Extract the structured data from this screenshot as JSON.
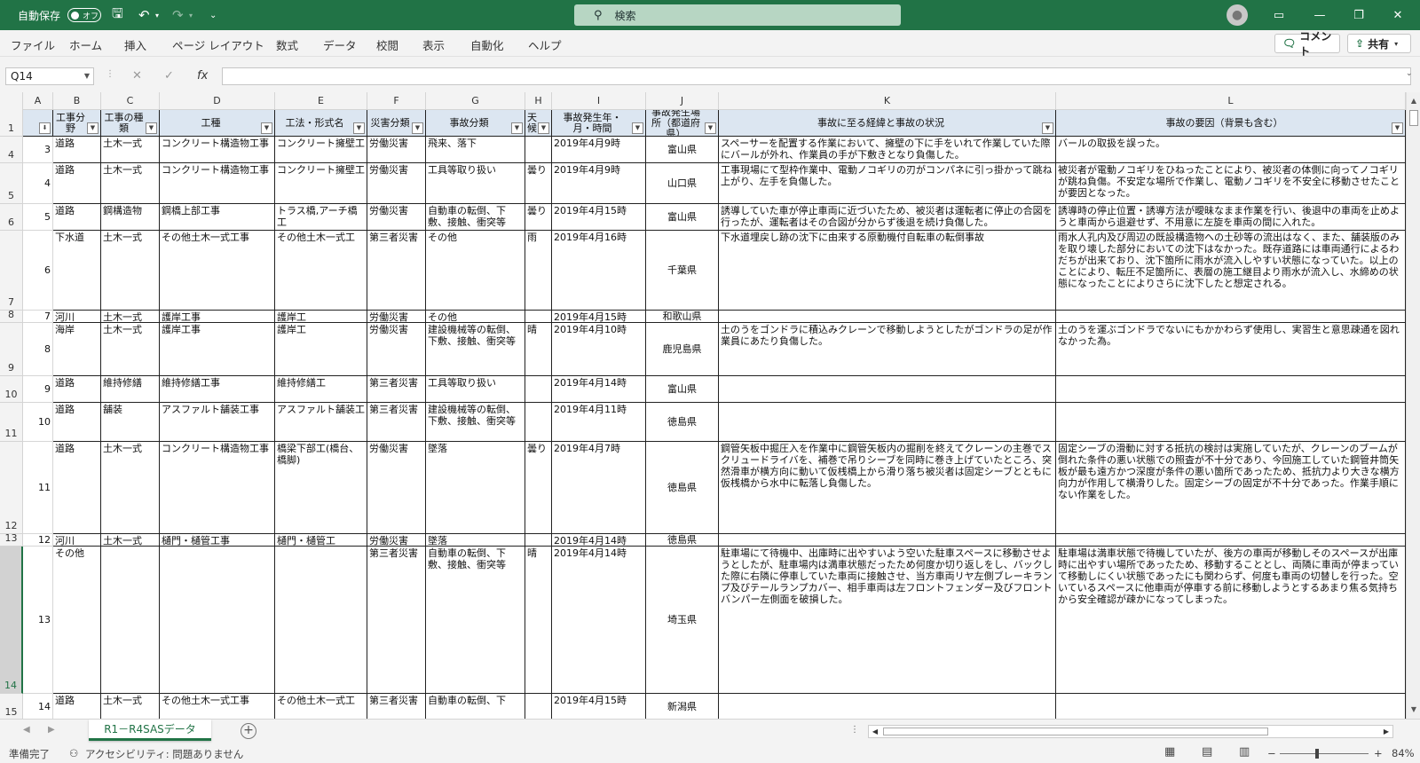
{
  "titlebar": {
    "autosave_label": "自動保存",
    "autosave_state": "オフ",
    "search_placeholder": "検索"
  },
  "ribbon": {
    "tabs": [
      "ファイル",
      "ホーム",
      "挿入",
      "ページ レイアウト",
      "数式",
      "データ",
      "校閲",
      "表示",
      "自動化",
      "ヘルプ"
    ],
    "comment_label": "コメント",
    "share_label": "共有"
  },
  "formula_bar": {
    "name_box": "Q14",
    "formula": ""
  },
  "columns": [
    "A",
    "B",
    "C",
    "D",
    "E",
    "F",
    "G",
    "H",
    "I",
    "J",
    "K",
    "L"
  ],
  "headers": {
    "A": "",
    "B": "工事分野",
    "C": "工事の種類",
    "D": "工種",
    "E": "工法・形式名",
    "F": "災害分類",
    "G": "事故分類",
    "H": "天候",
    "I": "事故発生年・月・時間",
    "J": "事故発生場所（都道府県）",
    "K": "事故に至る経緯と事故の状況",
    "L": "事故の要因（背景も含む）"
  },
  "rows": [
    {
      "rn": "4",
      "A": "3",
      "B": "道路",
      "C": "土木一式",
      "D": "コンクリート構造物工事",
      "E": "コンクリート擁壁工",
      "F": "労働災害",
      "G": "飛来、落下",
      "H": "",
      "I": "2019年4月9時",
      "J": "富山県",
      "K": "スペーサーを配置する作業において、擁壁の下に手をいれて作業していた際にバールが外れ、作業員の手が下敷きとなり負傷した。",
      "L": "バールの取扱を誤った。"
    },
    {
      "rn": "5",
      "A": "4",
      "B": "道路",
      "C": "土木一式",
      "D": "コンクリート構造物工事",
      "E": "コンクリート擁壁工",
      "F": "労働災害",
      "G": "工具等取り扱い",
      "H": "曇り",
      "I": "2019年4月9時",
      "J": "山口県",
      "K": "工事現場にて型枠作業中、電動ノコギリの刃がコンパネに引っ掛かって跳ね上がり、左手を負傷した。",
      "L": "被災者が電動ノコギリをひねったことにより、被災者の体側に向ってノコギリが跳ね負傷。不安定な場所で作業し、電動ノコギリを不安全に移動させたことが要因となった。"
    },
    {
      "rn": "6",
      "A": "5",
      "B": "道路",
      "C": "鋼構造物",
      "D": "鋼橋上部工事",
      "E": "トラス橋,アーチ橋工",
      "F": "労働災害",
      "G": "自動車の転倒、下敷、接触、衝突等",
      "H": "曇り",
      "I": "2019年4月15時",
      "J": "富山県",
      "K": "誘導していた車が停止車両に近づいたため、被災者は運転者に停止の合図を行ったが、運転者はその合図が分からず後退を続け負傷した。",
      "L": "誘導時の停止位置・誘導方法が曖昧なまま作業を行い、後退中の車両を止めようと車両から退避せず、不用意に左旋を車両の間に入れた。"
    },
    {
      "rn": "7",
      "A": "6",
      "B": "下水道",
      "C": "土木一式",
      "D": "その他土木一式工事",
      "E": "その他土木一式工",
      "F": "第三者災害",
      "G": "その他",
      "H": "雨",
      "I": "2019年4月16時",
      "J": "千葉県",
      "K": "下水道埋戻し跡の沈下に由来する原動機付自転車の転倒事故",
      "L": "雨水人孔内及び周辺の既設構造物への土砂等の流出はなく、また、舗装版のみを取り壊した部分においての沈下はなかった。既存道路には車両通行によるわだちが出来ており、沈下箇所に雨水が流入しやすい状態になっていた。以上のことにより、転圧不足箇所に、表層の施工継目より雨水が流入し、水締めの状態になったことによりさらに沈下したと想定される。"
    },
    {
      "rn": "8",
      "A": "7",
      "B": "河川",
      "C": "土木一式",
      "D": "護岸工事",
      "E": "護岸工",
      "F": "労働災害",
      "G": "その他",
      "H": "",
      "I": "2019年4月15時",
      "J": "和歌山県",
      "K": "",
      "L": ""
    },
    {
      "rn": "9",
      "A": "8",
      "B": "海岸",
      "C": "土木一式",
      "D": "護岸工事",
      "E": "護岸工",
      "F": "労働災害",
      "G": "建設機械等の転倒、下敷、接触、衝突等",
      "H": "晴",
      "I": "2019年4月10時",
      "J": "鹿児島県",
      "K": "土のうをゴンドラに積込みクレーンで移動しようとしたがゴンドラの足が作業員にあたり負傷した。",
      "L": "土のうを運ぶゴンドラでないにもかかわらず使用し、実習生と意思疎通を図れなかった為。"
    },
    {
      "rn": "10",
      "A": "9",
      "B": "道路",
      "C": "維持修繕",
      "D": "維持修繕工事",
      "E": "維持修繕工",
      "F": "第三者災害",
      "G": "工具等取り扱い",
      "H": "",
      "I": "2019年4月14時",
      "J": "富山県",
      "K": "",
      "L": ""
    },
    {
      "rn": "11",
      "A": "10",
      "B": "道路",
      "C": "舗装",
      "D": "アスファルト舗装工事",
      "E": "アスファルト舗装工",
      "F": "第三者災害",
      "G": "建設機械等の転倒、下敷、接触、衝突等",
      "H": "",
      "I": "2019年4月11時",
      "J": "徳島県",
      "K": "",
      "L": ""
    },
    {
      "rn": "12",
      "A": "11",
      "B": "道路",
      "C": "土木一式",
      "D": "コンクリート構造物工事",
      "E": "橋梁下部工(橋台、橋脚)",
      "F": "労働災害",
      "G": "墜落",
      "H": "曇り",
      "I": "2019年4月7時",
      "J": "徳島県",
      "K": "鋼管矢板中掘圧入を作業中に鋼管矢板内の掘削を終えてクレーンの主巻でスクリュードライバを、補巻で吊りシーブを同時に巻き上げていたところ、突然滑車が横方向に動いて仮桟橋上から滑り落ち被災者は固定シーブとともに仮桟橋から水中に転落し負傷した。",
      "L": "固定シーブの滑動に対する抵抗の検討は実施していたが、クレーンのブームが倒れた条件の悪い状態での照査が不十分であり、今回施工していた鋼管井筒矢板が最も遠方かつ深度が条件の悪い箇所であったため、抵抗力より大きな横方向力が作用して横滑りした。固定シーブの固定が不十分であった。作業手順にない作業をした。"
    },
    {
      "rn": "13",
      "A": "12",
      "B": "河川",
      "C": "土木一式",
      "D": "樋門・樋管工事",
      "E": "樋門・樋管工",
      "F": "労働災害",
      "G": "墜落",
      "H": "",
      "I": "2019年4月14時",
      "J": "徳島県",
      "K": "",
      "L": ""
    },
    {
      "rn": "14",
      "A": "13",
      "B": "その他",
      "C": "",
      "D": "",
      "E": "",
      "F": "第三者災害",
      "G": "自動車の転倒、下敷、接触、衝突等",
      "H": "晴",
      "I": "2019年4月14時",
      "J": "埼玉県",
      "K": "駐車場にて待機中、出庫時に出やすいよう空いた駐車スペースに移動させようとしたが、駐車場内は満車状態だったため何度か切り返しをし、バックした際に右隣に停車していた車両に接触させ、当方車両リヤ左側ブレーキランプ及びテールランプカバー、相手車両は左フロントフェンダー及びフロントバンパー左側面を破損した。",
      "L": "駐車場は満車状態で待機していたが、後方の車両が移動しそのスペースが出庫時に出やすい場所であったため、移動することとし、両隣に車両が停まっていて移動しにくい状態であったにも関わらず、何度も車両の切替しを行った。空いているスペースに他車両が停車する前に移動しようとするあまり焦る気持ちから安全確認が疎かになってしまった。"
    },
    {
      "rn": "15",
      "A": "14",
      "B": "道路",
      "C": "土木一式",
      "D": "その他土木一式工事",
      "E": "その他土木一式工",
      "F": "第三者災害",
      "G": "自動車の転倒、下",
      "H": "",
      "I": "2019年4月15時",
      "J": "新潟県",
      "K": "",
      "L": ""
    }
  ],
  "sheet": {
    "tab_name": "R1－R4SASデータ"
  },
  "status": {
    "ready": "準備完了",
    "accessibility": "アクセシビリティ: 問題ありません",
    "zoom": "84%"
  }
}
